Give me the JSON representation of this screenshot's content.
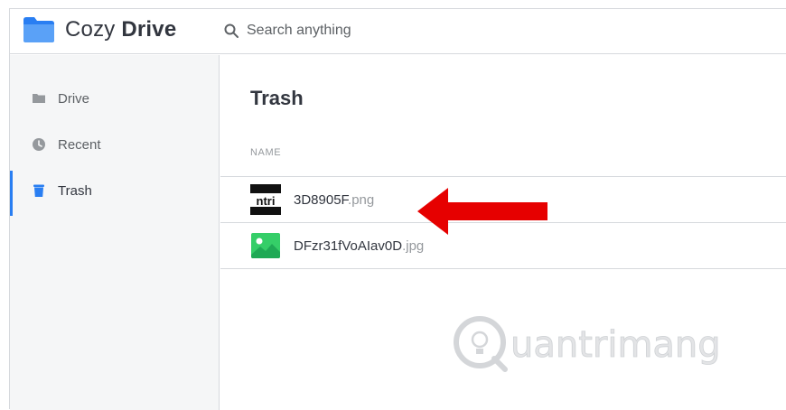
{
  "app": {
    "name_light": "Cozy",
    "name_bold": "Drive",
    "logo_icon": "folder-icon",
    "accent": "#297ef2"
  },
  "search": {
    "icon": "search-icon",
    "placeholder": "Search anything"
  },
  "sidebar": {
    "items": [
      {
        "label": "Drive",
        "icon": "folder-icon",
        "active": false
      },
      {
        "label": "Recent",
        "icon": "clock-icon",
        "active": false
      },
      {
        "label": "Trash",
        "icon": "trash-icon",
        "active": true
      }
    ]
  },
  "main": {
    "title": "Trash",
    "column_header": "NAME",
    "files": [
      {
        "name": "3D8905F",
        "ext": ".png",
        "thumb": "ntri-image-thumbnail"
      },
      {
        "name": "DFzr31fVoAIav0D",
        "ext": ".jpg",
        "thumb": "image-file-icon"
      }
    ]
  },
  "annotation": {
    "arrow_color": "#e60000"
  },
  "watermark": {
    "text": "uantrimang"
  }
}
